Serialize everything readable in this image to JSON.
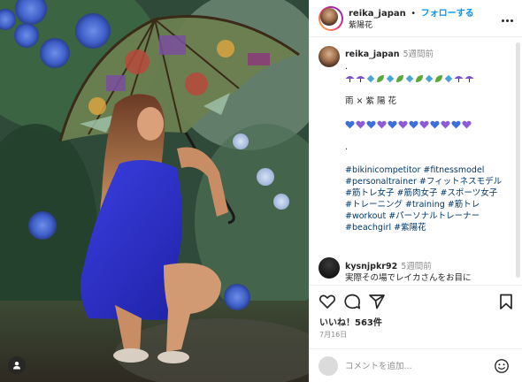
{
  "colors": {
    "accent": "#0095f6",
    "hashtag": "#00376b",
    "muted": "#8e8e8e",
    "text": "#262626"
  },
  "header": {
    "username": "reika_japan",
    "separator": "•",
    "follow_label": "フォローする",
    "location": "紫陽花",
    "more_icon": "more-horizontal-icon"
  },
  "caption": {
    "username": "reika_japan",
    "time": "5週間前",
    "lines": [
      ".",
      "雨 × 紫 陽 花",
      ".",
      "#bikinicompetitor #fitnessmodel",
      "#personaltrainer #フィットネスモデル",
      "#筋トレ女子 #筋肉女子 #スポーツ女子",
      "#トレーニング #training #筋トレ",
      "#workout #パーソナルトレーナー",
      "#beachgirl #紫陽花"
    ],
    "symbol_row_icons": [
      "umbrella-icon",
      "umbrella-icon",
      "diamond-icon",
      "leaf-icon",
      "diamond-icon",
      "leaf-icon",
      "diamond-icon",
      "leaf-icon",
      "diamond-icon",
      "leaf-icon",
      "diamond-icon",
      "umbrella-icon",
      "umbrella-icon"
    ],
    "heart_row_colors": [
      "#3d6fd9",
      "#8e5bd6",
      "#3d6fd9",
      "#8e5bd6",
      "#3d6fd9",
      "#8e5bd6",
      "#3d6fd9",
      "#8e5bd6",
      "#3d6fd9",
      "#8e5bd6",
      "#3d6fd9",
      "#8e5bd6"
    ]
  },
  "comment": {
    "username": "kysnjpkr92",
    "time": "5週間前",
    "text": "実際その場でレイカさんをお目に"
  },
  "actions": {
    "like_icon": "heart-icon",
    "comment_icon": "comment-icon",
    "share_icon": "share-icon",
    "save_icon": "bookmark-icon"
  },
  "likes_label": "いいね！563件",
  "date_label": "7月16日",
  "comment_box": {
    "placeholder": "コメントを追加...",
    "emoji_icon": "emoji-icon"
  },
  "photo": {
    "user_tag_icon": "user-tag-icon"
  }
}
